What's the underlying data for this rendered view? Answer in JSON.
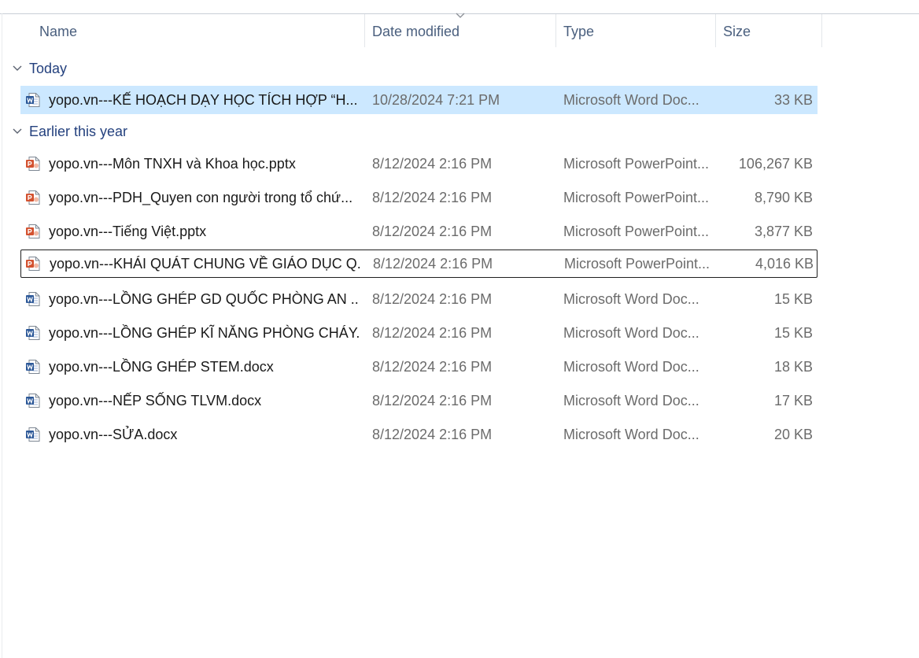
{
  "columns": {
    "name": "Name",
    "date_modified": "Date modified",
    "type": "Type",
    "size": "Size"
  },
  "sort": {
    "column": "Date modified",
    "direction": "descending"
  },
  "colors": {
    "selection": "#cce8ff",
    "group_header": "#24417e",
    "word_icon": "#2b5797",
    "powerpoint_icon": "#d35230"
  },
  "groups": [
    {
      "label": "Today",
      "files": [
        {
          "name": "yopo.vn---KẾ HOẠCH DẠY HỌC TÍCH HỢP “H...",
          "date": "10/28/2024 7:21 PM",
          "type": "Microsoft Word Doc...",
          "size": "33 KB",
          "icon": "word-doc-icon",
          "selected": true
        }
      ]
    },
    {
      "label": "Earlier this year",
      "files": [
        {
          "name": "yopo.vn---Môn TNXH và Khoa học.pptx",
          "date": "8/12/2024 2:16 PM",
          "type": "Microsoft PowerPoint...",
          "size": "106,267 KB",
          "icon": "powerpoint-doc-icon"
        },
        {
          "name": "yopo.vn---PDH_Quyen con người trong tổ chứ...",
          "date": "8/12/2024 2:16 PM",
          "type": "Microsoft PowerPoint...",
          "size": "8,790 KB",
          "icon": "powerpoint-doc-icon"
        },
        {
          "name": "yopo.vn---Tiếng Việt.pptx",
          "date": "8/12/2024 2:16 PM",
          "type": "Microsoft PowerPoint...",
          "size": "3,877 KB",
          "icon": "powerpoint-doc-icon"
        },
        {
          "name": "yopo.vn---KHÁI QUÁT CHUNG VỀ GIÁO DỤC Q...",
          "date": "8/12/2024 2:16 PM",
          "type": "Microsoft PowerPoint...",
          "size": "4,016 KB",
          "icon": "powerpoint-doc-icon",
          "focused": true
        },
        {
          "name": "yopo.vn---LỒNG GHÉP GD QUỐC PHÒNG AN ...",
          "date": "8/12/2024 2:16 PM",
          "type": "Microsoft Word Doc...",
          "size": "15 KB",
          "icon": "word-doc-icon"
        },
        {
          "name": "yopo.vn---LỒNG GHÉP KĨ NĂNG PHÒNG CHÁY...",
          "date": "8/12/2024 2:16 PM",
          "type": "Microsoft Word Doc...",
          "size": "15 KB",
          "icon": "word-doc-icon"
        },
        {
          "name": "yopo.vn---LỒNG GHÉP STEM.docx",
          "date": "8/12/2024 2:16 PM",
          "type": "Microsoft Word Doc...",
          "size": "18 KB",
          "icon": "word-doc-icon"
        },
        {
          "name": "yopo.vn---NẾP SỐNG TLVM.docx",
          "date": "8/12/2024 2:16 PM",
          "type": "Microsoft Word Doc...",
          "size": "17 KB",
          "icon": "word-doc-icon"
        },
        {
          "name": "yopo.vn---SỬA.docx",
          "date": "8/12/2024 2:16 PM",
          "type": "Microsoft Word Doc...",
          "size": "20 KB",
          "icon": "word-doc-icon"
        }
      ]
    }
  ]
}
